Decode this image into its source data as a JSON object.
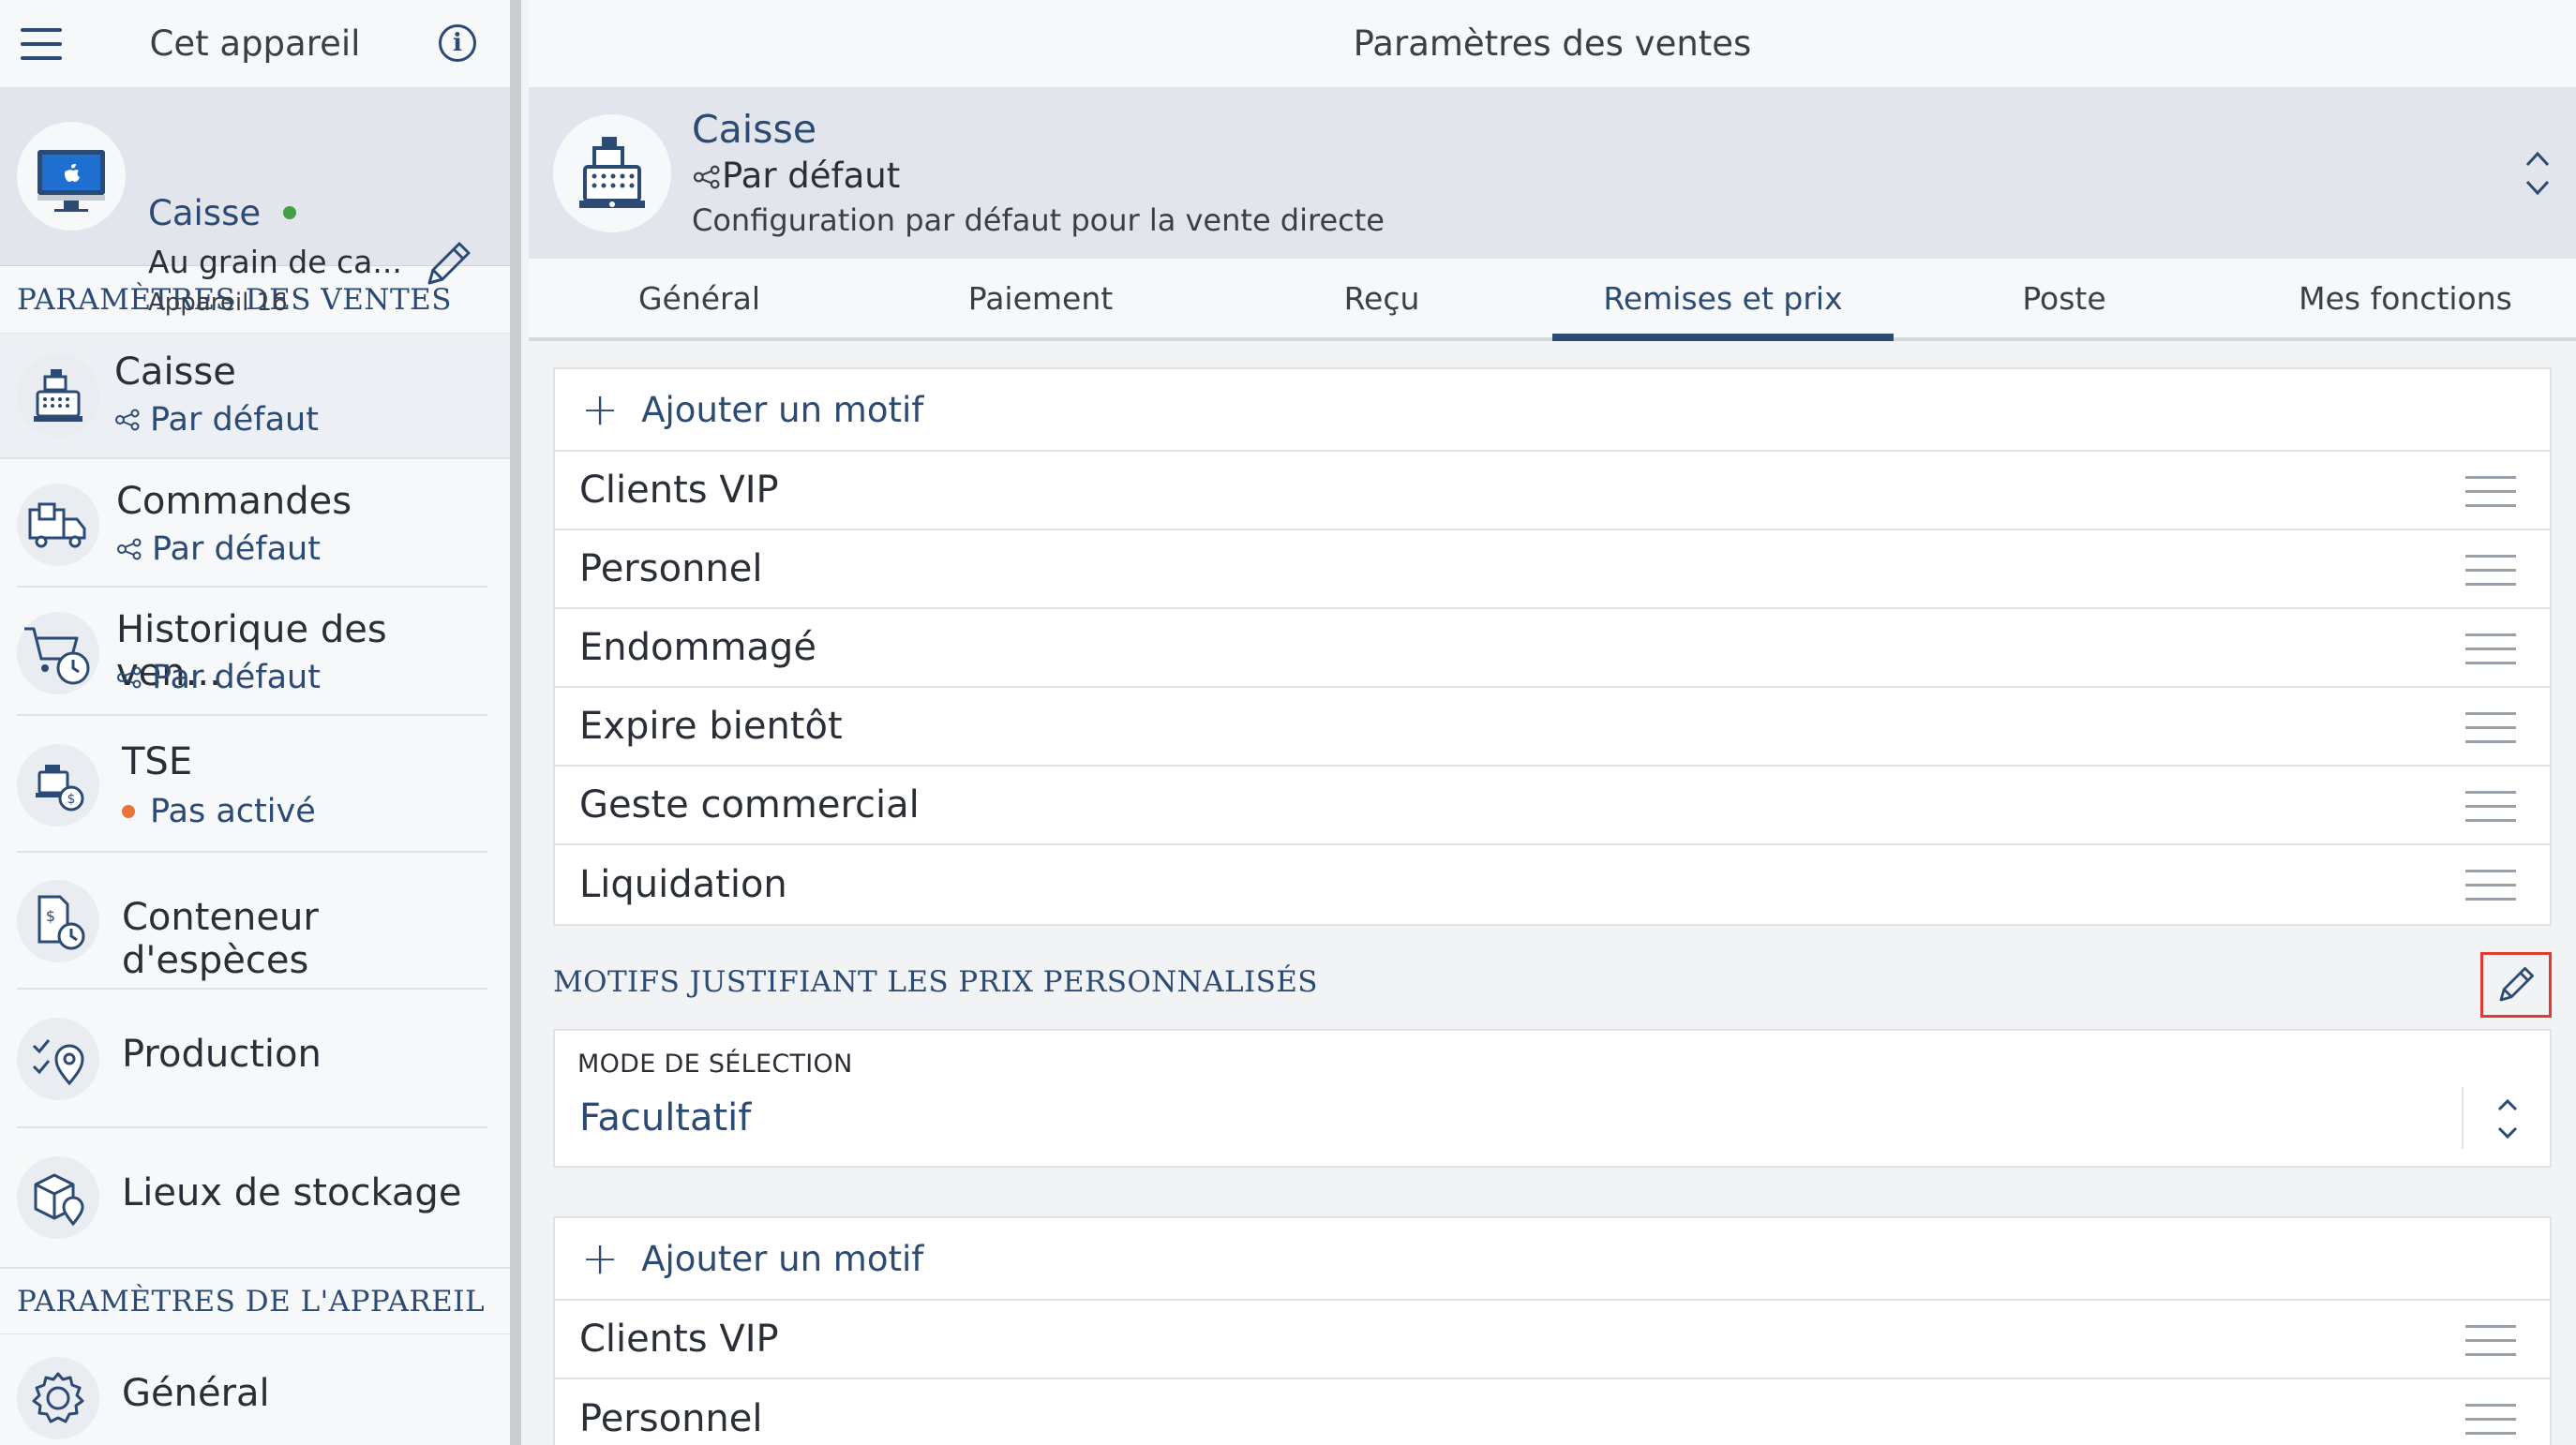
{
  "sidebar": {
    "title": "Cet appareil",
    "device": {
      "name": "Caisse",
      "status_color": "#43a047",
      "location": "Au grain de ca...",
      "device_label": "Appareil 16"
    },
    "sales_section": "PARAMÈTRES DES VENTES",
    "items": [
      {
        "name": "Caisse",
        "sub": "Par défaut",
        "icon": "cash-register-icon"
      },
      {
        "name": "Commandes",
        "sub": "Par défaut",
        "icon": "delivery-truck-icon"
      },
      {
        "name": "Historique des ven...",
        "sub": "Par défaut",
        "icon": "cart-history-icon"
      },
      {
        "name": "TSE",
        "sub": "Pas activé",
        "icon": "tse-icon",
        "status_color": "#e8743b"
      },
      {
        "name": "Conteneur d'espèces",
        "icon": "cash-container-icon"
      },
      {
        "name": "Production",
        "icon": "production-icon"
      },
      {
        "name": "Lieux de stockage",
        "icon": "storage-locations-icon"
      }
    ],
    "device_section": "PARAMÈTRES DE L'APPAREIL",
    "device_items": [
      {
        "name": "Général",
        "icon": "gear-icon"
      }
    ]
  },
  "main": {
    "title": "Paramètres des ventes",
    "header": {
      "name": "Caisse",
      "profile": "Par défaut",
      "description": "Configuration par défaut pour la vente directe"
    },
    "tabs": [
      {
        "label": "Général"
      },
      {
        "label": "Paiement"
      },
      {
        "label": "Reçu"
      },
      {
        "label": "Remises et prix",
        "active": true
      },
      {
        "label": "Poste"
      },
      {
        "label": "Mes fonctions"
      }
    ],
    "discount_reasons": {
      "add_label": "Ajouter un motif",
      "items": [
        "Clients VIP",
        "Personnel",
        "Endommagé",
        "Expire bientôt",
        "Geste commercial",
        "Liquidation"
      ]
    },
    "custom_price_section": {
      "title": "MOTIFS JUSTIFIANT LES PRIX PERSONNALISÉS",
      "mode_label": "MODE DE SÉLECTION",
      "mode_value": "Facultatif",
      "add_label": "Ajouter un motif",
      "items": [
        "Clients VIP",
        "Personnel"
      ]
    }
  },
  "colors": {
    "accent": "#2b4a74",
    "highlight_border": "#e53935",
    "online": "#43a047",
    "inactive": "#e8743b"
  }
}
